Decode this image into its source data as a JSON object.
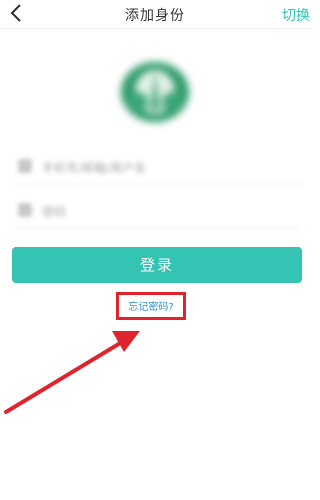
{
  "header": {
    "title": "添加身份",
    "switch_label": "切换"
  },
  "form": {
    "account_placeholder": "手机号/邮箱/用户名",
    "password_placeholder": "密码"
  },
  "login_button": "登录",
  "forgot_password": "忘记密码?",
  "colors": {
    "accent": "#35c4b3",
    "highlight": "#e0232c",
    "link": "#2f8fce"
  }
}
